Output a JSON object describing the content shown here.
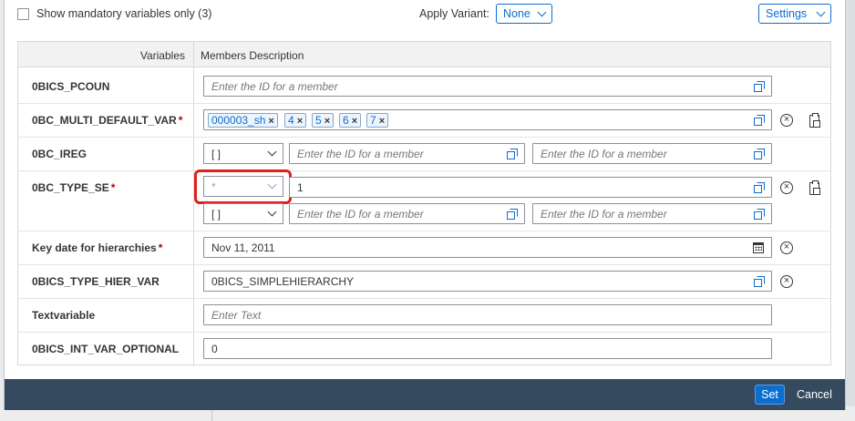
{
  "header": {
    "checkbox_label": "Show mandatory variables only (3)",
    "apply_variant_label": "Apply Variant:",
    "variant_value": "None",
    "settings_label": "Settings"
  },
  "table": {
    "col_variables": "Variables",
    "col_members": "Members Description"
  },
  "placeholders": {
    "member_id": "Enter the ID for a member",
    "text": "Enter Text"
  },
  "rows": {
    "pcoun": {
      "name": "0BICS_PCOUN"
    },
    "multi": {
      "name": "0BC_MULTI_DEFAULT_VAR",
      "required": "*",
      "tokens": [
        "000003_sh",
        "4",
        "5",
        "6",
        "7"
      ],
      "token_remove": "×"
    },
    "ireg": {
      "name": "0BC_IREG",
      "operator": "[ ]"
    },
    "type_se": {
      "name": "0BC_TYPE_SE",
      "required": "*",
      "operator1": "*",
      "value1": "1",
      "operator2": "[ ]"
    },
    "keydate": {
      "name": "Key date for hierarchies",
      "required": "*",
      "value": "Nov 11, 2011"
    },
    "type_hier": {
      "name": "0BICS_TYPE_HIER_VAR",
      "value": "0BICS_SIMPLEHIERARCHY"
    },
    "textvar": {
      "name": "Textvariable"
    },
    "int_opt": {
      "name": "0BICS_INT_VAR_OPTIONAL",
      "value": "0"
    }
  },
  "icons": {
    "clear": "×"
  },
  "footer": {
    "set_label": "Set",
    "cancel_label": "Cancel"
  },
  "colors": {
    "accent": "#0a6ed1",
    "footer_bg": "#354a5f",
    "required": "#bb0000",
    "highlight": "#e0211b"
  }
}
